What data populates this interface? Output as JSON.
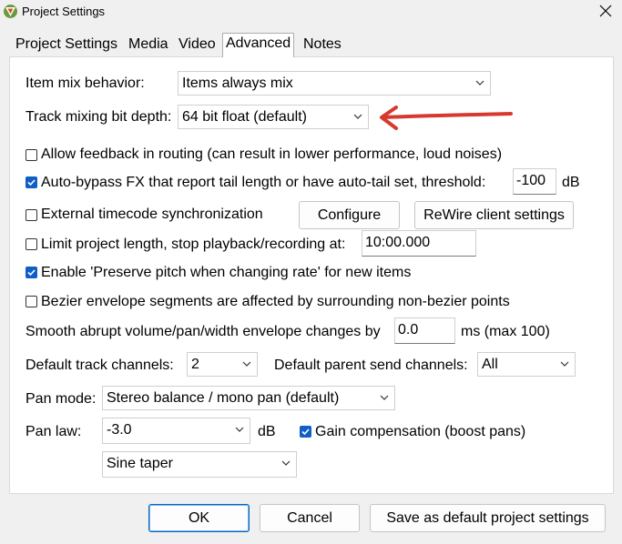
{
  "window": {
    "title": "Project Settings"
  },
  "tabs": [
    {
      "label": "Project Settings"
    },
    {
      "label": "Media"
    },
    {
      "label": "Video"
    },
    {
      "label": "Advanced"
    },
    {
      "label": "Notes"
    }
  ],
  "settings": {
    "item_mix": {
      "label": "Item mix behavior:",
      "value": "Items always mix"
    },
    "bit_depth": {
      "label": "Track mixing bit depth:",
      "value": "64 bit float (default)"
    },
    "allow_feedback": {
      "label": "Allow feedback in routing (can result in lower performance, loud noises)",
      "checked": false
    },
    "auto_bypass": {
      "label": "Auto-bypass FX that report tail length or have auto-tail set, threshold:",
      "checked": true,
      "value": "-100",
      "unit": "dB"
    },
    "external_timecode": {
      "label": "External timecode synchronization",
      "checked": false
    },
    "configure_button": "Configure",
    "rewire_button": "ReWire client settings",
    "limit_length": {
      "label": "Limit project length, stop playback/recording at:",
      "checked": false,
      "value": "10:00.000"
    },
    "preserve_pitch": {
      "label": "Enable 'Preserve pitch when changing rate' for new items",
      "checked": true
    },
    "bezier": {
      "label": "Bezier envelope segments are affected by surrounding non-bezier points",
      "checked": false
    },
    "smooth": {
      "label": "Smooth abrupt volume/pan/width envelope changes by",
      "value": "0.0",
      "suffix": "ms (max 100)"
    },
    "track_channels": {
      "label": "Default track channels:",
      "value": "2"
    },
    "parent_send": {
      "label": "Default parent send channels:",
      "value": "All"
    },
    "pan_mode": {
      "label": "Pan mode:",
      "value": "Stereo balance / mono pan (default)"
    },
    "pan_law": {
      "label": "Pan law:",
      "value": "-3.0",
      "unit": "dB"
    },
    "gain_comp": {
      "label": "Gain compensation (boost pans)",
      "checked": true
    },
    "taper": {
      "value": "Sine taper"
    }
  },
  "buttons": {
    "ok": "OK",
    "cancel": "Cancel",
    "save_default": "Save as default project settings"
  },
  "annotation": {
    "color": "#d6392e"
  }
}
